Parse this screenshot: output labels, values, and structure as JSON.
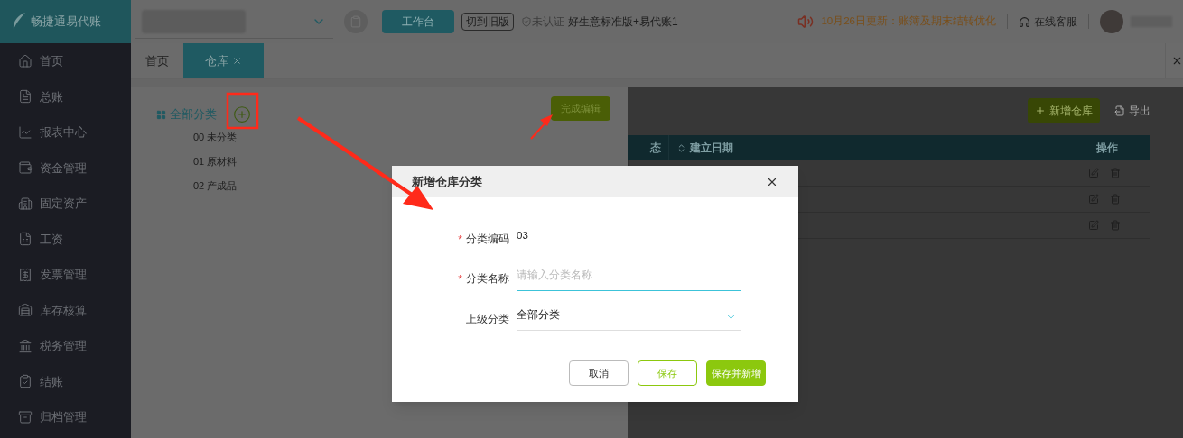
{
  "logo": {
    "text": "畅捷通易代账"
  },
  "topbar": {
    "workbench_button": "工作台",
    "switch_button": "切到旧版",
    "cert_status": "未认证",
    "product": "好生意标准版+易代账1",
    "notice": "10月26日更新：账簿及期末结转优化",
    "support": "在线客服"
  },
  "sidebar": {
    "items": [
      {
        "label": "首页"
      },
      {
        "label": "总账"
      },
      {
        "label": "报表中心"
      },
      {
        "label": "资金管理"
      },
      {
        "label": "固定资产"
      },
      {
        "label": "工资"
      },
      {
        "label": "发票管理"
      },
      {
        "label": "库存核算"
      },
      {
        "label": "税务管理"
      },
      {
        "label": "结账"
      },
      {
        "label": "归档管理"
      }
    ]
  },
  "tabs": [
    {
      "label": "首页",
      "selected": false,
      "closable": false
    },
    {
      "label": "仓库",
      "selected": true,
      "closable": true
    }
  ],
  "tree": {
    "root": "全部分类",
    "items": [
      "00 未分类",
      "01 原材料",
      "02 产成品"
    ],
    "done_button": "完成编辑"
  },
  "table": {
    "add_button": "新增仓库",
    "export": "导出",
    "columns": [
      {
        "label": "态",
        "sortable": false
      },
      {
        "label": "建立日期",
        "sortable": true
      },
      {
        "label": "操作",
        "sortable": false
      }
    ],
    "rows": [
      {
        "kind": "actions"
      },
      {
        "kind": "actions"
      },
      {
        "kind": "actions"
      }
    ]
  },
  "dialog": {
    "title": "新增仓库分类",
    "fields": [
      {
        "label": "分类编码",
        "required_mark": "*",
        "value": "03",
        "focused": false,
        "kind": "text"
      },
      {
        "label": "分类名称",
        "required_mark": "*",
        "placeholder": "请输入分类名称",
        "focused": true,
        "kind": "text"
      },
      {
        "label": "上级分类",
        "value": "全部分类",
        "focused": false,
        "kind": "select"
      }
    ],
    "buttons": [
      {
        "label": "取消",
        "kind": "default"
      },
      {
        "label": "保存",
        "kind": "outline"
      },
      {
        "label": "保存并新增",
        "kind": "primary"
      }
    ]
  }
}
